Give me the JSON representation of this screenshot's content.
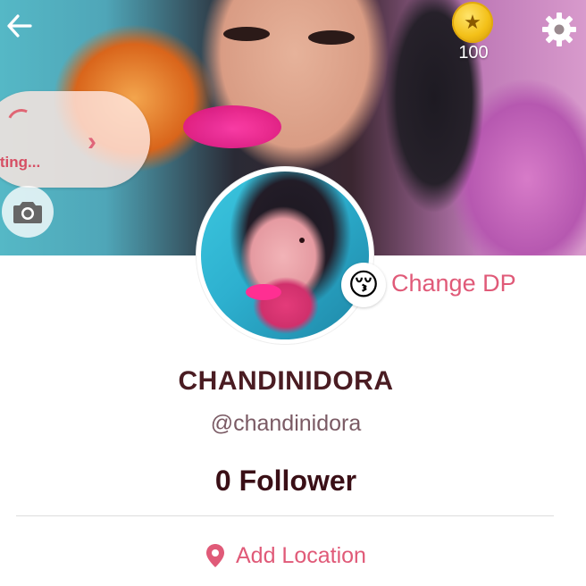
{
  "header": {
    "back_icon": "arrow-left-icon",
    "coin_icon": "gold-coin-star-icon",
    "coin_count": "100",
    "settings_icon": "gear-icon"
  },
  "posting": {
    "label": "osting...",
    "spinner_icon": "spinner-icon",
    "chevron_icon": "chevron-right-icon"
  },
  "cover": {
    "camera_icon": "camera-icon"
  },
  "avatar": {
    "emoji": "😚",
    "change_dp_label": "Change DP"
  },
  "profile": {
    "display_name": "CHANDINIDORA",
    "username": "@chandinidora",
    "followers": "0 Follower"
  },
  "location": {
    "icon": "location-pin-icon",
    "label": "Add Location"
  },
  "colors": {
    "accent": "#e05a78",
    "name_text": "#4a1c22",
    "username_text": "#7a5a64",
    "coin": "#f3c018"
  }
}
